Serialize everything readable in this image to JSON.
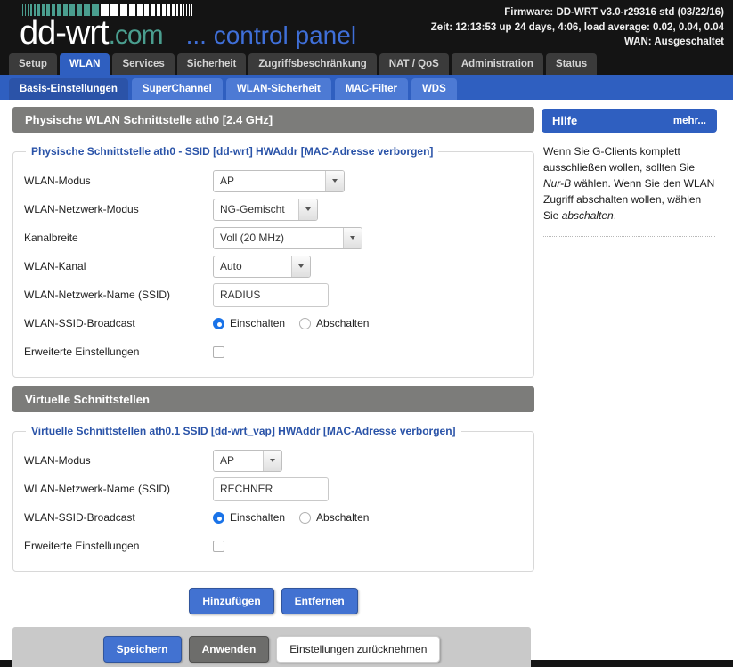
{
  "header": {
    "brand_main": "dd-wrt",
    "brand_tld": ".com",
    "brand_sub": "... control panel",
    "firmware": "Firmware: DD-WRT v3.0-r29316 std (03/22/16)",
    "uptime": "Zeit: 12:13:53 up 24 days, 4:06, load average: 0.02, 0.04, 0.04",
    "wan": "WAN: Ausgeschaltet",
    "logo_bar_color": "#4a9e8f"
  },
  "tabs": [
    {
      "label": "Setup",
      "active": false
    },
    {
      "label": "WLAN",
      "active": true
    },
    {
      "label": "Services",
      "active": false
    },
    {
      "label": "Sicherheit",
      "active": false
    },
    {
      "label": "Zugriffsbeschränkung",
      "active": false
    },
    {
      "label": "NAT / QoS",
      "active": false
    },
    {
      "label": "Administration",
      "active": false
    },
    {
      "label": "Status",
      "active": false
    }
  ],
  "subtabs": [
    {
      "label": "Basis-Einstellungen",
      "active": true
    },
    {
      "label": "SuperChannel",
      "active": false
    },
    {
      "label": "WLAN-Sicherheit",
      "active": false
    },
    {
      "label": "MAC-Filter",
      "active": false
    },
    {
      "label": "WDS",
      "active": false
    }
  ],
  "physical": {
    "panel_title": "Physische WLAN Schnittstelle ath0 [2.4 GHz]",
    "legend": "Physische Schnittstelle ath0 - SSID [dd-wrt] HWAddr [MAC-Adresse verborgen]",
    "fields": {
      "mode_label": "WLAN-Modus",
      "mode_value": "AP",
      "netmode_label": "WLAN-Netzwerk-Modus",
      "netmode_value": "NG-Gemischt",
      "bandwidth_label": "Kanalbreite",
      "bandwidth_value": "Voll (20 MHz)",
      "channel_label": "WLAN-Kanal",
      "channel_value": "Auto",
      "ssid_label": "WLAN-Netzwerk-Name (SSID)",
      "ssid_value": "RADIUS",
      "broadcast_label": "WLAN-SSID-Broadcast",
      "broadcast_on": "Einschalten",
      "broadcast_off": "Abschalten",
      "broadcast_selected": "Einschalten",
      "advanced_label": "Erweiterte Einstellungen",
      "advanced_checked": false
    }
  },
  "virtual": {
    "panel_title": "Virtuelle Schnittstellen",
    "legend": "Virtuelle Schnittstellen ath0.1 SSID [dd-wrt_vap] HWAddr [MAC-Adresse verborgen]",
    "fields": {
      "mode_label": "WLAN-Modus",
      "mode_value": "AP",
      "ssid_label": "WLAN-Netzwerk-Name (SSID)",
      "ssid_value": "RECHNER",
      "broadcast_label": "WLAN-SSID-Broadcast",
      "broadcast_on": "Einschalten",
      "broadcast_off": "Abschalten",
      "broadcast_selected": "Einschalten",
      "advanced_label": "Erweiterte Einstellungen",
      "advanced_checked": false
    },
    "add_button": "Hinzufügen",
    "remove_button": "Entfernen"
  },
  "footer": {
    "save": "Speichern",
    "apply": "Anwenden",
    "cancel": "Einstellungen zurücknehmen"
  },
  "help": {
    "title": "Hilfe",
    "more": "mehr...",
    "text_1": "Wenn Sie G-Clients komplett ausschließen wollen, sollten Sie ",
    "emphasis_1": "Nur-B",
    "text_2": " wählen. Wenn Sie den WLAN Zugriff abschalten wollen, wählen Sie ",
    "emphasis_2": "abschalten",
    "text_3": "."
  }
}
